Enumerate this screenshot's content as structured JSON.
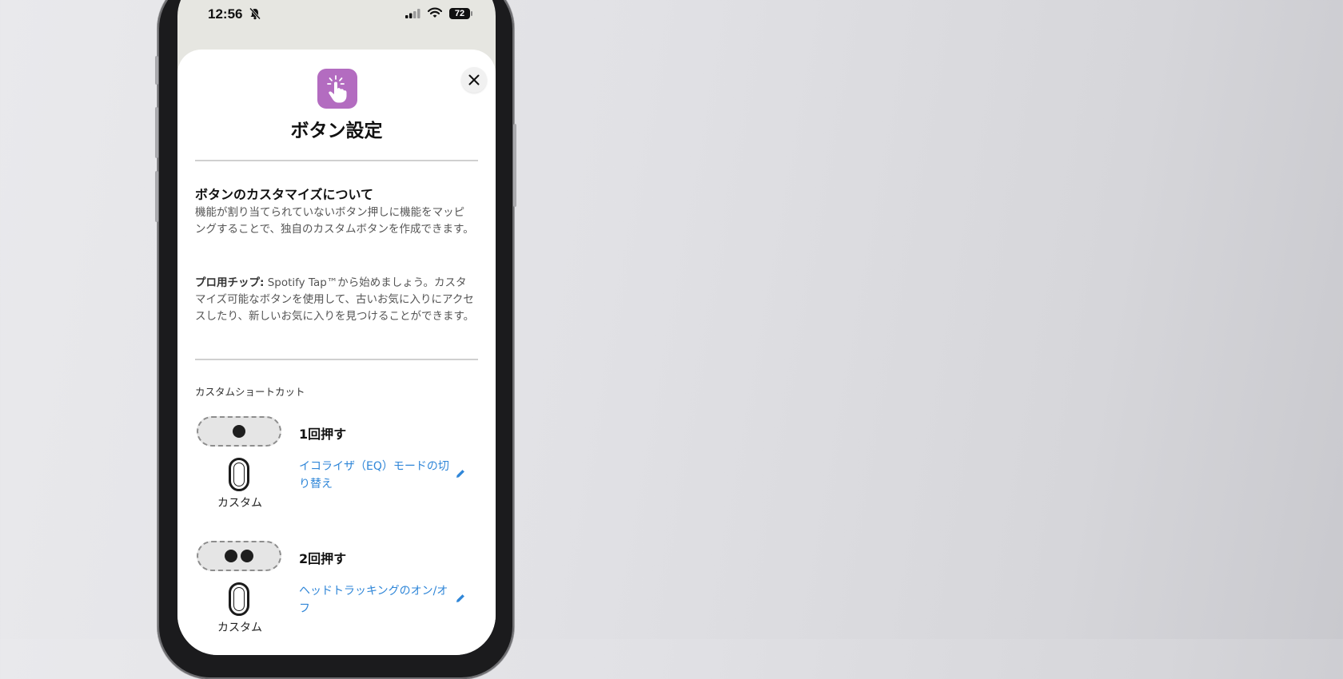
{
  "status_bar": {
    "time": "12:56",
    "battery": "72",
    "icons": [
      "bell-slash-icon",
      "signal-icon",
      "wifi-icon",
      "battery-icon"
    ]
  },
  "sheet": {
    "app_icon": "tap-finger-icon",
    "close_icon": "close-icon",
    "title": "ボタン設定",
    "about_heading": "ボタンのカスタマイズについて",
    "about_body": "機能が割り当てられていないボタン押しに機能をマッピングすることで、独自のカスタムボタンを作成できます。",
    "tip_label": "プロ用チップ:",
    "tip_body": " Spotify Tap™から始めましょう。カスタマイズ可能なボタンを使用して、古いお気に入りにアクセスしたり、新しいお気に入りを見つけることができます。",
    "shortcuts_heading": "カスタムショートカット",
    "shortcuts": [
      {
        "press": "1回押す",
        "dots": 1,
        "bud_label": "カスタム",
        "action": "イコライザ（EQ）モードの切り替え"
      },
      {
        "press": "2回押す",
        "dots": 2,
        "bud_label": "カスタム",
        "action": "ヘッドトラッキングのオン/オフ"
      }
    ]
  },
  "colors": {
    "accent": "#2f86d8",
    "app_icon_bg": "#b36cc0",
    "sheet_bg": "#ffffff",
    "screen_bg": "#e6e6e1"
  }
}
